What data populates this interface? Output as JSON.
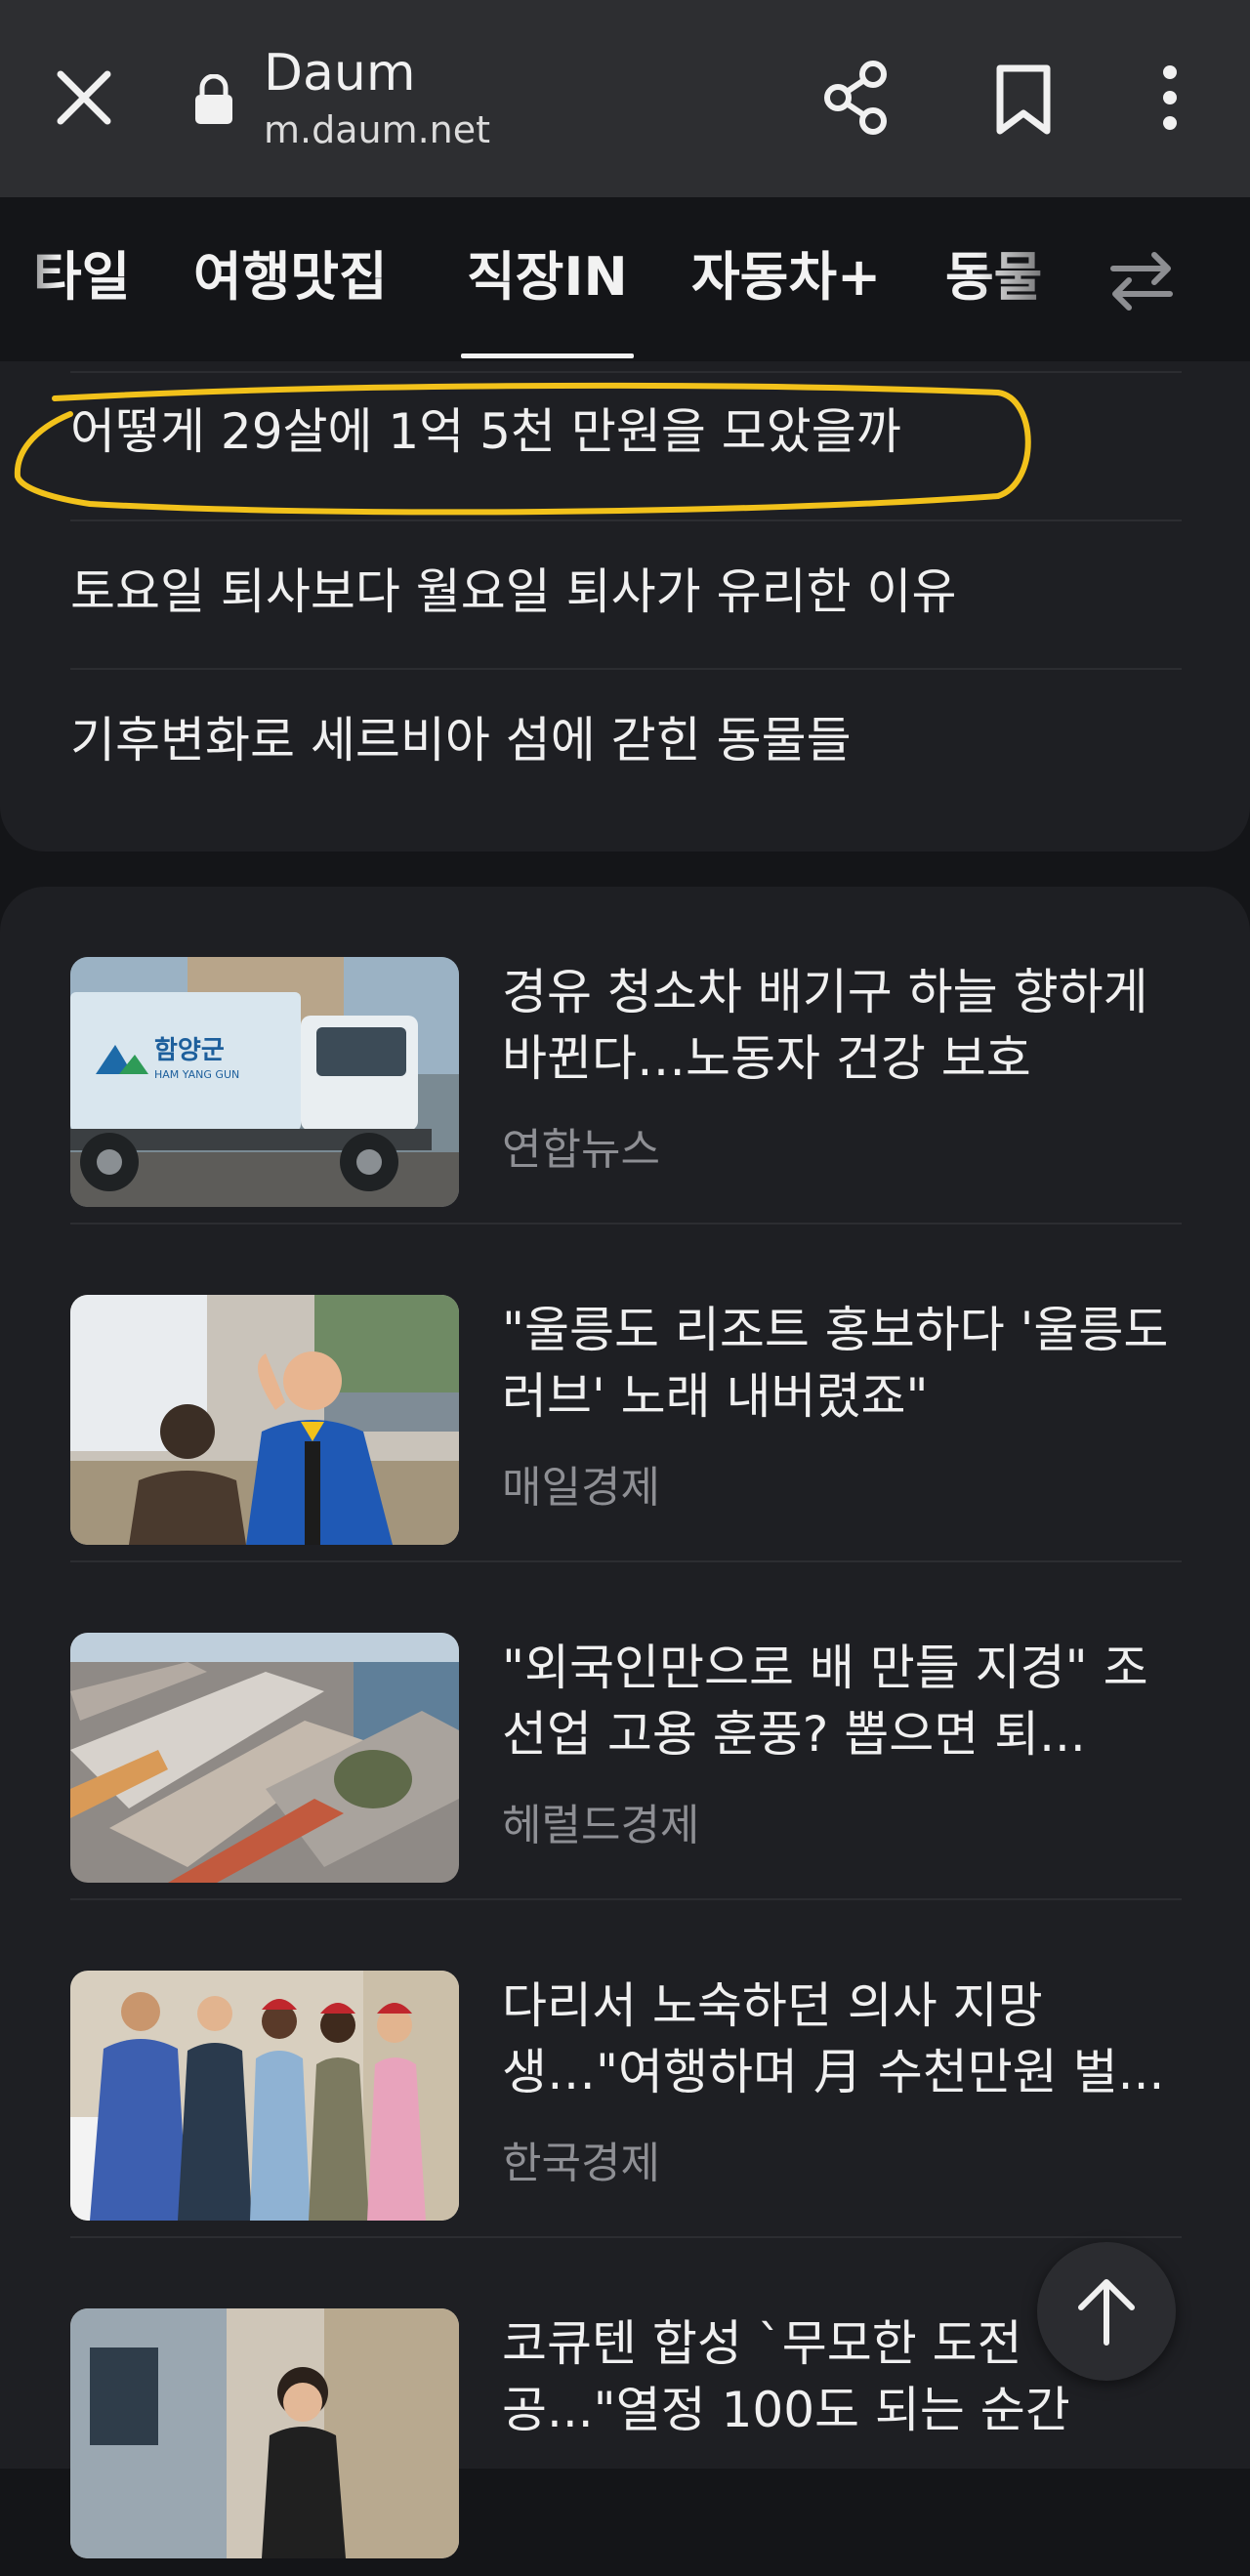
{
  "browser": {
    "site_title": "Daum",
    "site_url": "m.daum.net",
    "icons": [
      "close-icon",
      "lock-icon",
      "share-icon",
      "bookmark-icon",
      "more-vertical-icon"
    ]
  },
  "tabs": {
    "items": [
      "타일",
      "여행맛집",
      "직장IN",
      "자동차+",
      "동물"
    ],
    "active": "직장IN",
    "swap_icon": "swap-arrows-icon"
  },
  "headlines": [
    "어떻게 29살에 1억 5천 만원을 모았을까",
    "토요일 퇴사보다 월요일 퇴사가 유리한 이유",
    "기후변화로 세르비아 섬에 갇힌 동물들"
  ],
  "news": [
    {
      "title": "경유 청소차 배기구 하늘 향하게 바뀐다…노동자 건강 보호",
      "source": "연합뉴스",
      "thumb_logo": "함양군",
      "thumb_sub": "HAM YANG GUN"
    },
    {
      "title": "\"울릉도 리조트 홍보하다 '울릉도 러브' 노래 내버렸죠\"",
      "source": "매일경제"
    },
    {
      "title": "\"외국인만으로 배 만들 지경\" 조선업 고용 훈풍? 뽑으면 퇴...",
      "source": "헤럴드경제"
    },
    {
      "title": "다리서 노숙하던 의사 지망생…\"여행하며 月 수천만원 벌...",
      "source": "한국경제"
    },
    {
      "title": "코큐텐 합성 `무모한 도전 공...\"열정 100도 되는 순간",
      "source": ""
    }
  ],
  "colors": {
    "background": "#141518",
    "card": "#1e1f23",
    "browser_bar": "#2d2e31",
    "highlight": "#f2c21b",
    "source_text": "#8e8f94"
  }
}
